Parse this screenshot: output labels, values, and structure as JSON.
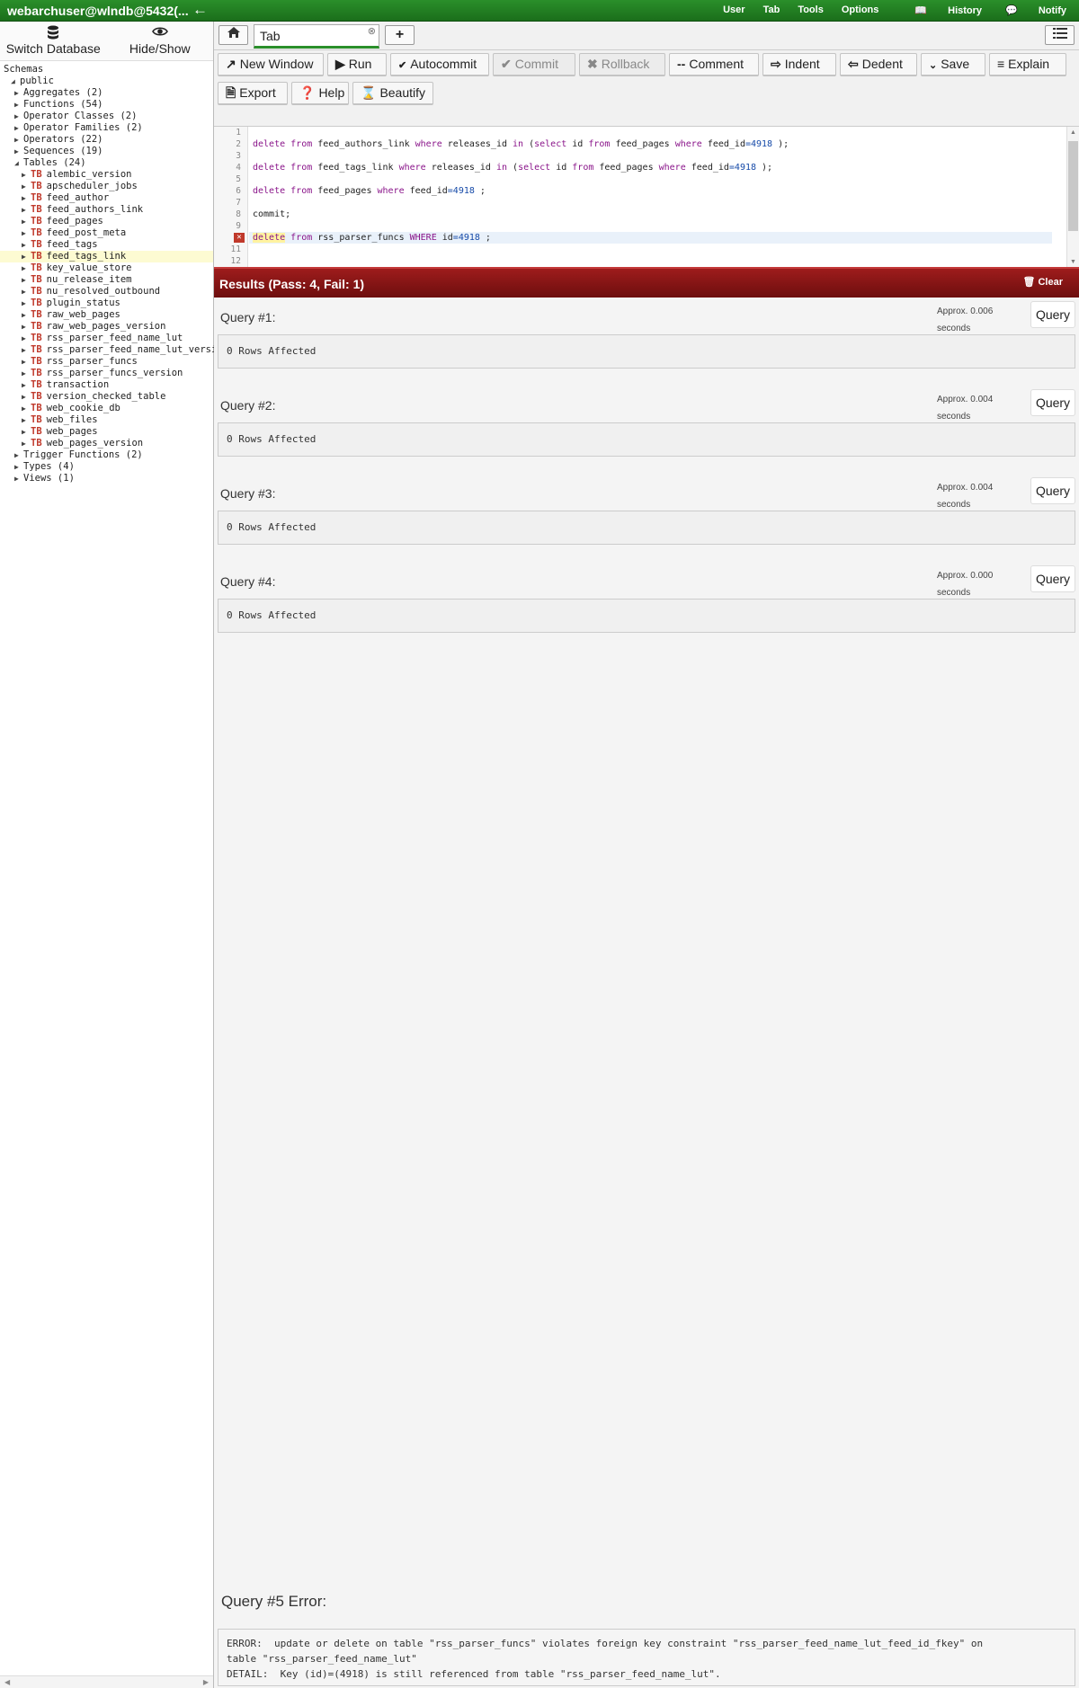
{
  "topbar": {
    "connection": "webarchuser@wlndb@5432(...",
    "menu": [
      "User",
      "Tab",
      "Tools",
      "Options",
      "History",
      "Notify"
    ]
  },
  "sidebar": {
    "switch_db": "Switch Database",
    "hide_show": "Hide/Show",
    "tree": [
      {
        "label": "Schemas",
        "level": 0,
        "arrow": ""
      },
      {
        "label": "public",
        "level": 1,
        "arrow": "◢"
      },
      {
        "label": "Aggregates (2)",
        "level": 2,
        "arrow": "▶"
      },
      {
        "label": "Functions (54)",
        "level": 2,
        "arrow": "▶"
      },
      {
        "label": "Operator Classes (2)",
        "level": 2,
        "arrow": "▶"
      },
      {
        "label": "Operator Families (2)",
        "level": 2,
        "arrow": "▶"
      },
      {
        "label": "Operators (22)",
        "level": 2,
        "arrow": "▶"
      },
      {
        "label": "Sequences (19)",
        "level": 2,
        "arrow": "▶"
      },
      {
        "label": "Tables (24)",
        "level": 2,
        "arrow": "◢"
      },
      {
        "label": "alembic_version",
        "level": 3,
        "arrow": "▶",
        "tb": true
      },
      {
        "label": "apscheduler_jobs",
        "level": 3,
        "arrow": "▶",
        "tb": true
      },
      {
        "label": "feed_author",
        "level": 3,
        "arrow": "▶",
        "tb": true
      },
      {
        "label": "feed_authors_link",
        "level": 3,
        "arrow": "▶",
        "tb": true
      },
      {
        "label": "feed_pages",
        "level": 3,
        "arrow": "▶",
        "tb": true
      },
      {
        "label": "feed_post_meta",
        "level": 3,
        "arrow": "▶",
        "tb": true
      },
      {
        "label": "feed_tags",
        "level": 3,
        "arrow": "▶",
        "tb": true
      },
      {
        "label": "feed_tags_link",
        "level": 3,
        "arrow": "▶",
        "tb": true,
        "selected": true
      },
      {
        "label": "key_value_store",
        "level": 3,
        "arrow": "▶",
        "tb": true
      },
      {
        "label": "nu_release_item",
        "level": 3,
        "arrow": "▶",
        "tb": true
      },
      {
        "label": "nu_resolved_outbound",
        "level": 3,
        "arrow": "▶",
        "tb": true
      },
      {
        "label": "plugin_status",
        "level": 3,
        "arrow": "▶",
        "tb": true
      },
      {
        "label": "raw_web_pages",
        "level": 3,
        "arrow": "▶",
        "tb": true
      },
      {
        "label": "raw_web_pages_version",
        "level": 3,
        "arrow": "▶",
        "tb": true
      },
      {
        "label": "rss_parser_feed_name_lut",
        "level": 3,
        "arrow": "▶",
        "tb": true
      },
      {
        "label": "rss_parser_feed_name_lut_versi",
        "level": 3,
        "arrow": "▶",
        "tb": true
      },
      {
        "label": "rss_parser_funcs",
        "level": 3,
        "arrow": "▶",
        "tb": true
      },
      {
        "label": "rss_parser_funcs_version",
        "level": 3,
        "arrow": "▶",
        "tb": true
      },
      {
        "label": "transaction",
        "level": 3,
        "arrow": "▶",
        "tb": true
      },
      {
        "label": "version_checked_table",
        "level": 3,
        "arrow": "▶",
        "tb": true
      },
      {
        "label": "web_cookie_db",
        "level": 3,
        "arrow": "▶",
        "tb": true
      },
      {
        "label": "web_files",
        "level": 3,
        "arrow": "▶",
        "tb": true
      },
      {
        "label": "web_pages",
        "level": 3,
        "arrow": "▶",
        "tb": true
      },
      {
        "label": "web_pages_version",
        "level": 3,
        "arrow": "▶",
        "tb": true
      },
      {
        "label": "Trigger Functions (2)",
        "level": 2,
        "arrow": "▶"
      },
      {
        "label": "Types (4)",
        "level": 2,
        "arrow": "▶"
      },
      {
        "label": "Views (1)",
        "level": 2,
        "arrow": "▶"
      }
    ],
    "tb_badge": "TB"
  },
  "tabs": {
    "active_label": "Tab"
  },
  "toolbar": {
    "new_window": "New Window",
    "run": "Run",
    "autocommit": "Autocommit",
    "commit": "Commit",
    "rollback": "Rollback",
    "comment": "Comment",
    "indent": "Indent",
    "dedent": "Dedent",
    "save": "Save",
    "explain": "Explain",
    "export": "Export",
    "help": "Help",
    "beautify": "Beautify"
  },
  "editor": {
    "line_numbers": [
      "1",
      "2",
      "3",
      "4",
      "5",
      "6",
      "7",
      "8",
      "9",
      "10",
      "11",
      "12"
    ],
    "error_line": 10,
    "lines": [
      [],
      [
        [
          "kw",
          "delete"
        ],
        [
          "t",
          " "
        ],
        [
          "kw",
          "from"
        ],
        [
          "t",
          " feed_authors_link "
        ],
        [
          "kw",
          "where"
        ],
        [
          "t",
          " releases_id "
        ],
        [
          "kw",
          "in"
        ],
        [
          "t",
          " ("
        ],
        [
          "kw",
          "select"
        ],
        [
          "t",
          " id "
        ],
        [
          "kw",
          "from"
        ],
        [
          "t",
          " feed_pages "
        ],
        [
          "kw",
          "where"
        ],
        [
          "t",
          " feed_id"
        ],
        [
          "num",
          "=4918"
        ],
        [
          "t",
          " );"
        ]
      ],
      [],
      [
        [
          "kw",
          "delete"
        ],
        [
          "t",
          " "
        ],
        [
          "kw",
          "from"
        ],
        [
          "t",
          " feed_tags_link "
        ],
        [
          "kw",
          "where"
        ],
        [
          "t",
          " releases_id "
        ],
        [
          "kw",
          "in"
        ],
        [
          "t",
          " ("
        ],
        [
          "kw",
          "select"
        ],
        [
          "t",
          " id "
        ],
        [
          "kw",
          "from"
        ],
        [
          "t",
          " feed_pages "
        ],
        [
          "kw",
          "where"
        ],
        [
          "t",
          " feed_id"
        ],
        [
          "num",
          "=4918"
        ],
        [
          "t",
          " );"
        ]
      ],
      [],
      [
        [
          "kw",
          "delete"
        ],
        [
          "t",
          " "
        ],
        [
          "kw",
          "from"
        ],
        [
          "t",
          " feed_pages "
        ],
        [
          "kw",
          "where"
        ],
        [
          "t",
          " feed_id"
        ],
        [
          "num",
          "=4918"
        ],
        [
          "t",
          " ;"
        ]
      ],
      [],
      [
        [
          "t",
          "commit;"
        ]
      ],
      [],
      [
        [
          "err",
          "delete"
        ],
        [
          "t",
          " "
        ],
        [
          "kw",
          "from"
        ],
        [
          "t",
          " rss_parser_funcs "
        ],
        [
          "kw",
          "WHERE"
        ],
        [
          "t",
          " id"
        ],
        [
          "num",
          "=4918"
        ],
        [
          "t",
          " ;"
        ]
      ],
      [],
      []
    ]
  },
  "results": {
    "title": "Results (Pass: 4, Fail: 1)",
    "clear": "Clear",
    "query_button": "Query",
    "queries": [
      {
        "title": "Query #1:",
        "time_line1": "Approx. 0.006",
        "time_line2": "seconds",
        "result": "0 Rows Affected"
      },
      {
        "title": "Query #2:",
        "time_line1": "Approx. 0.004",
        "time_line2": "seconds",
        "result": "0 Rows Affected"
      },
      {
        "title": "Query #3:",
        "time_line1": "Approx. 0.004",
        "time_line2": "seconds",
        "result": "0 Rows Affected"
      },
      {
        "title": "Query #4:",
        "time_line1": "Approx. 0.000",
        "time_line2": "seconds",
        "result": "0 Rows Affected"
      }
    ],
    "error_title": "Query #5 Error:",
    "error_text": "ERROR:  update or delete on table \"rss_parser_funcs\" violates foreign key constraint \"rss_parser_feed_name_lut_feed_id_fkey\" on\ntable \"rss_parser_feed_name_lut\"\nDETAIL:  Key (id)=(4918) is still referenced from table \"rss_parser_feed_name_lut\"."
  }
}
